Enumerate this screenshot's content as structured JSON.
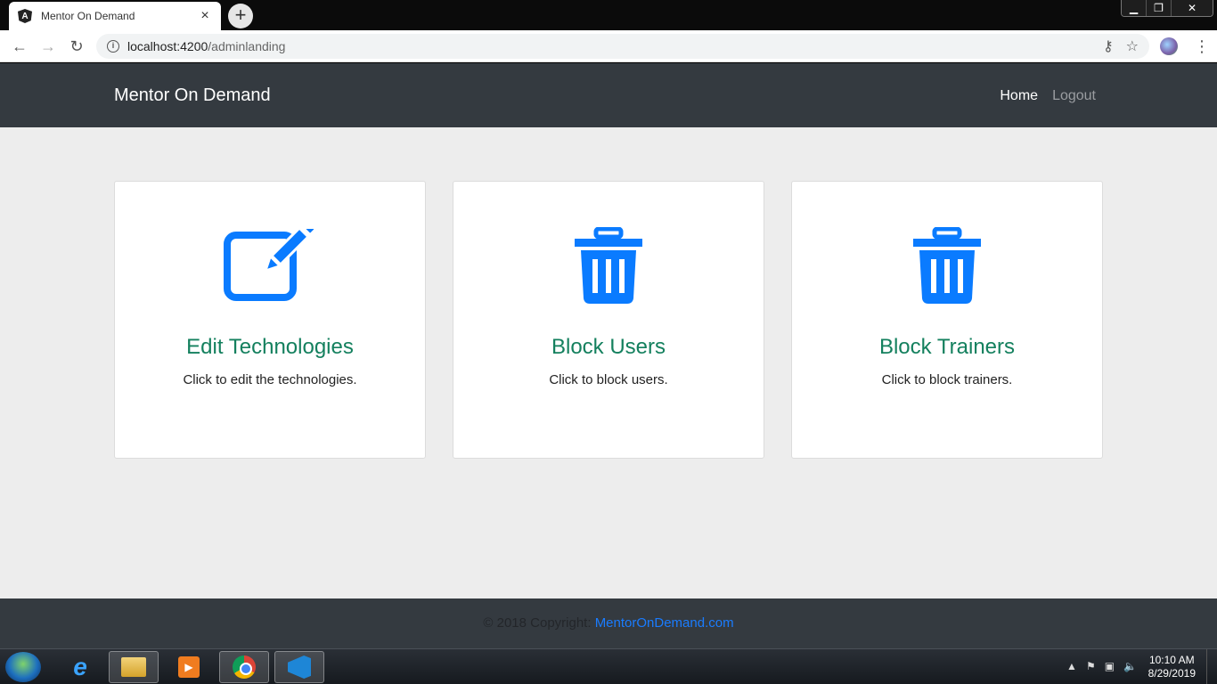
{
  "browser": {
    "tab_title": "Mento r On Demand",
    "tab_close": "×",
    "new_tab": "+",
    "url_host": "localhost:4200",
    "url_path": "/adminlanding",
    "window_buttons": {
      "minimize": "▁",
      "maximize": "❐",
      "close": "✕"
    }
  },
  "navbar": {
    "brand": "Mentor On Demand",
    "links": {
      "home": "Home",
      "logout": "Logout"
    }
  },
  "cards": [
    {
      "icon": "edit-icon",
      "title": "Edit Technologies",
      "text": "Click to edit the technologies."
    },
    {
      "icon": "trash-icon",
      "title": "Block Users",
      "text": "Click to block users."
    },
    {
      "icon": "trash-icon",
      "title": "Block Trainers",
      "text": "Click to block trainers."
    }
  ],
  "footer": {
    "copyright": "© 2018 Copyright:",
    "link": "MentorOnDemand.com"
  },
  "taskbar": {
    "time": "10:10 AM",
    "date": "8/29/2019"
  },
  "colors": {
    "navbar_bg": "#343a40",
    "icon_blue": "#0a7bff",
    "title_green": "#14805e",
    "page_bg": "#ededed"
  }
}
